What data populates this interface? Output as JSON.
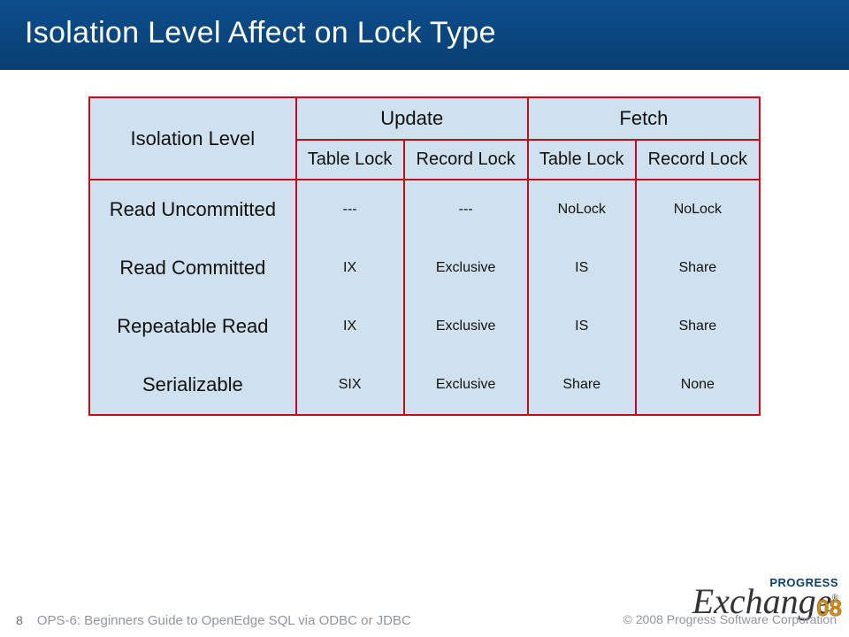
{
  "slide": {
    "title": "Isolation Level Affect on Lock Type",
    "page_number": "8",
    "footer_text": "OPS-6: Beginners Guide to OpenEdge SQL via ODBC or JDBC",
    "copyright": "© 2008 Progress Software Corporation",
    "logo": {
      "brand": "PROGRESS",
      "product": "Exchange",
      "year": "08",
      "reg": "®"
    }
  },
  "table": {
    "headers": {
      "row_header": "Isolation Level",
      "groups": [
        "Update",
        "Fetch"
      ],
      "subcols": [
        "Table Lock",
        "Record Lock",
        "Table Lock",
        "Record Lock"
      ]
    },
    "rows": [
      {
        "label": "Read Uncommitted",
        "cells": [
          "---",
          "---",
          "NoLock",
          "NoLock"
        ]
      },
      {
        "label": "Read Committed",
        "cells": [
          "IX",
          "Exclusive",
          "IS",
          "Share"
        ]
      },
      {
        "label": "Repeatable Read",
        "cells": [
          "IX",
          "Exclusive",
          "IS",
          "Share"
        ]
      },
      {
        "label": "Serializable",
        "cells": [
          "SIX",
          "Exclusive",
          "Share",
          "None"
        ]
      }
    ]
  }
}
